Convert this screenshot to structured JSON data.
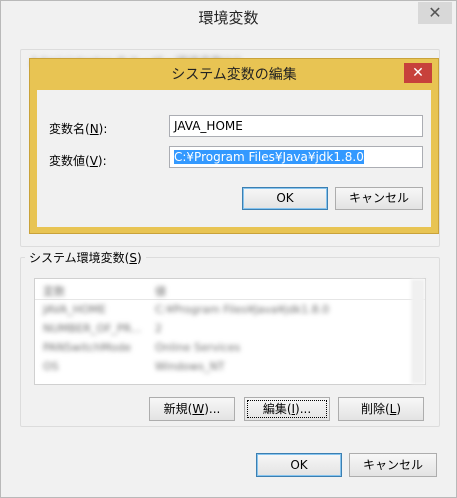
{
  "outer_dialog": {
    "title": "環境変数",
    "close_glyph": "✕",
    "user_vars_label_blurred": "Administrator のユーザー環境変数(U)",
    "system_vars": {
      "label": "システム環境変数(",
      "label_mnemonic": "S",
      "label_end": ")",
      "columns": [
        "変数",
        "値"
      ],
      "rows": [
        [
          "JAVA_HOME",
          "C:¥Program Files¥Java¥jdk1.8.0"
        ],
        [
          "NUMBER_OF_PR...",
          "2"
        ],
        [
          "PANSwitchMode",
          "Online Services"
        ],
        [
          "OS",
          "Windows_NT"
        ]
      ]
    },
    "buttons": {
      "new": {
        "text": "新規(",
        "mnemonic": "W",
        "end": ")..."
      },
      "edit": {
        "text": "編集(",
        "mnemonic": "I",
        "end": ")..."
      },
      "delete": {
        "text": "削除(",
        "mnemonic": "L",
        "end": ")"
      },
      "ok": "OK",
      "cancel": "キャンセル"
    }
  },
  "edit_dialog": {
    "title": "システム変数の編集",
    "close_glyph": "✕",
    "accent_color": "#e8c453",
    "name_label": {
      "text": "変数名(",
      "mnemonic": "N",
      "end": "):"
    },
    "value_label": {
      "text": "変数値(",
      "mnemonic": "V",
      "end": "):"
    },
    "name_value": "JAVA_HOME",
    "value_value": "C:¥Program Files¥Java¥jdk1.8.0",
    "ok": "OK",
    "cancel": "キャンセル"
  }
}
